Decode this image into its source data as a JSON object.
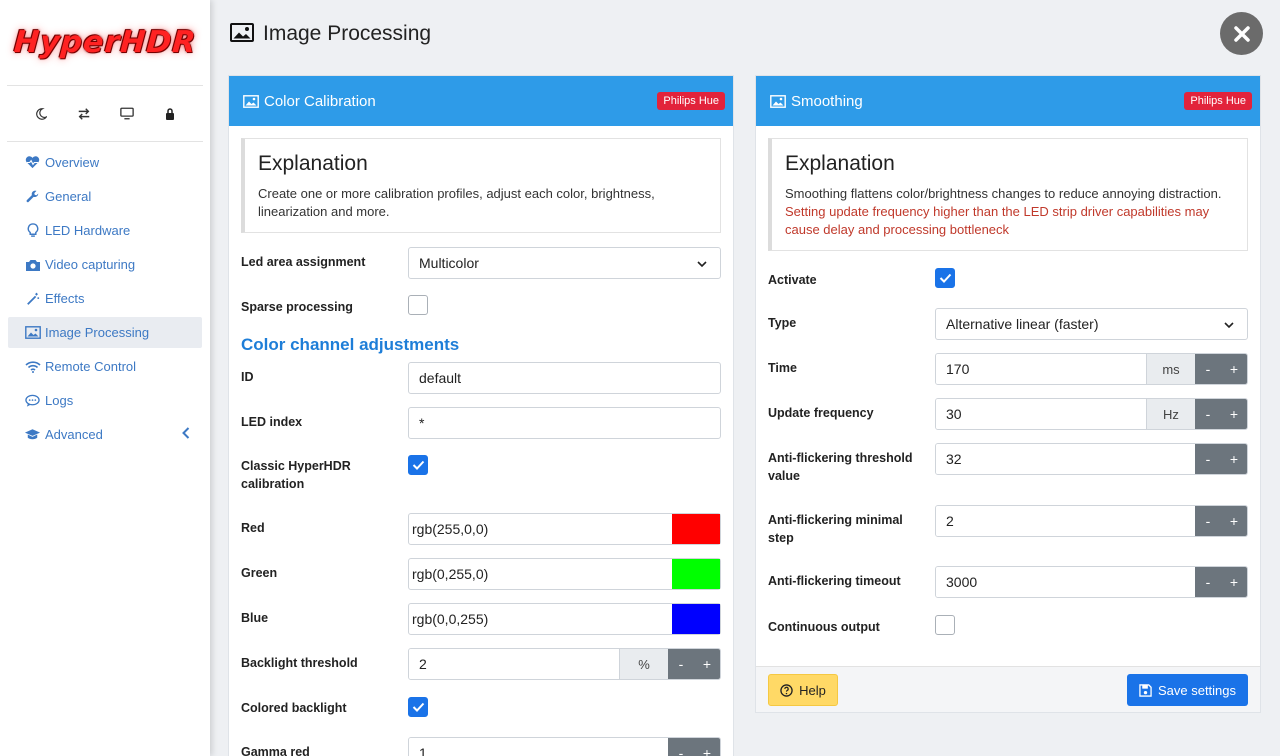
{
  "app": {
    "logo_text": "HyperHDR"
  },
  "sidebar": {
    "icons": [
      "moon-icon",
      "swap-icon",
      "monitor-icon",
      "lock-icon"
    ],
    "items": [
      {
        "label": "Overview",
        "icon": "heartbeat-icon"
      },
      {
        "label": "General",
        "icon": "wrench-icon"
      },
      {
        "label": "LED Hardware",
        "icon": "lightbulb-icon"
      },
      {
        "label": "Video capturing",
        "icon": "camera-icon"
      },
      {
        "label": "Effects",
        "icon": "magic-wand-icon"
      },
      {
        "label": "Image Processing",
        "icon": "image-icon",
        "active": true
      },
      {
        "label": "Remote Control",
        "icon": "wifi-icon"
      },
      {
        "label": "Logs",
        "icon": "chat-icon"
      },
      {
        "label": "Advanced",
        "icon": "graduation-cap-icon"
      }
    ]
  },
  "page": {
    "title": "Image Processing"
  },
  "color_calibration": {
    "title": "Color Calibration",
    "badge": "Philips Hue",
    "explain_title": "Explanation",
    "explain_text": "Create one or more calibration profiles, adjust each color, brightness, linearization and more.",
    "led_area_label": "Led area assignment",
    "led_area_value": "Multicolor",
    "sparse_label": "Sparse processing",
    "section_title": "Color channel adjustments",
    "id_label": "ID",
    "id_value": "default",
    "led_index_label": "LED index",
    "led_index_value": "*",
    "classic_label": "Classic HyperHDR calibration",
    "red_label": "Red",
    "red_value": "rgb(255,0,0)",
    "red_color": "#ff0000",
    "green_label": "Green",
    "green_value": "rgb(0,255,0)",
    "green_color": "#00ff00",
    "blue_label": "Blue",
    "blue_value": "rgb(0,0,255)",
    "blue_color": "#0000ff",
    "backlight_label": "Backlight threshold",
    "backlight_value": "2",
    "backlight_unit": "%",
    "colored_backlight_label": "Colored backlight",
    "gamma_red_label": "Gamma red",
    "gamma_red_value": "1"
  },
  "smoothing": {
    "title": "Smoothing",
    "badge": "Philips Hue",
    "explain_title": "Explanation",
    "explain_text": "Smoothing flattens color/brightness changes to reduce annoying distraction.",
    "explain_warn": "Setting update frequency higher than the LED strip driver capabilities may cause delay and processing bottleneck",
    "activate_label": "Activate",
    "type_label": "Type",
    "type_value": "Alternative linear (faster)",
    "time_label": "Time",
    "time_value": "170",
    "time_unit": "ms",
    "freq_label": "Update frequency",
    "freq_value": "30",
    "freq_unit": "Hz",
    "af_threshold_label": "Anti-flickering threshold value",
    "af_threshold_value": "32",
    "af_step_label": "Anti-flickering minimal step",
    "af_step_value": "2",
    "af_timeout_label": "Anti-flickering timeout",
    "af_timeout_value": "3000",
    "continuous_label": "Continuous output",
    "help_label": "Help",
    "save_label": "Save settings"
  },
  "buttons": {
    "minus": "-",
    "plus": "+"
  },
  "colors": {
    "header_blue": "#2e9be8",
    "badge_red": "#e2233b",
    "link_blue": "#3d79c4",
    "primary": "#1a73e8",
    "help_yellow": "#ffd966"
  }
}
